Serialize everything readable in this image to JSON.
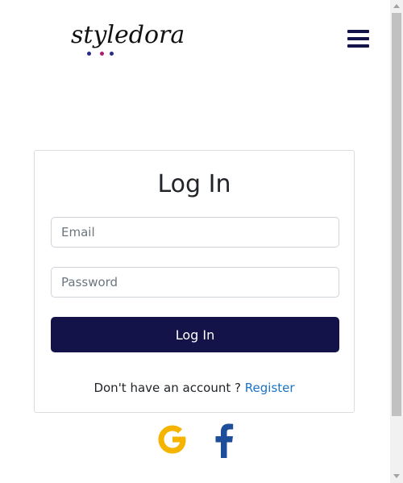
{
  "brand": {
    "name": "styledora",
    "dot_colors": [
      "#2a2a8a",
      "#b01e6e",
      "#2a2a8a"
    ]
  },
  "header": {
    "menu_icon": "hamburger-menu-icon",
    "menu_color": "#13134a"
  },
  "login": {
    "title": "Log In",
    "email_placeholder": "Email",
    "password_placeholder": "Password",
    "submit_label": "Log In",
    "no_account_text": "Don't have an account ?",
    "register_label": "Register"
  },
  "social": {
    "google_icon": "google-icon",
    "google_color": "#f5b400",
    "facebook_icon": "facebook-icon",
    "facebook_color": "#1e4d9a"
  },
  "colors": {
    "primary": "#13134a",
    "link": "#1a73c9"
  }
}
